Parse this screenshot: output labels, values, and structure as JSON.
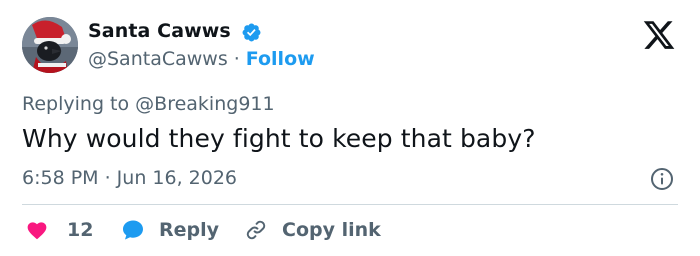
{
  "header": {
    "display_name": "Santa Cawws",
    "handle": "@SantaCawws",
    "separator": "·",
    "follow_label": "Follow"
  },
  "reply_context": {
    "prefix": "Replying to",
    "mention": "@Breaking911"
  },
  "tweet": {
    "text": "Why would they fight to keep that baby?",
    "timestamp": "6:58 PM · Jun 16, 2026"
  },
  "actions": {
    "like_count": "12",
    "reply_label": "Reply",
    "copy_link_label": "Copy link"
  },
  "colors": {
    "verified": "#1d9bf0",
    "follow": "#1d9bf0",
    "like": "#f91880",
    "reply": "#1d9bf0",
    "muted": "#536471",
    "text": "#0f1419"
  },
  "icons": {
    "brand": "x-logo-icon",
    "verified": "verified-badge-icon",
    "info": "info-icon",
    "like": "heart-icon",
    "reply": "speech-bubble-icon",
    "copy_link": "link-icon"
  }
}
